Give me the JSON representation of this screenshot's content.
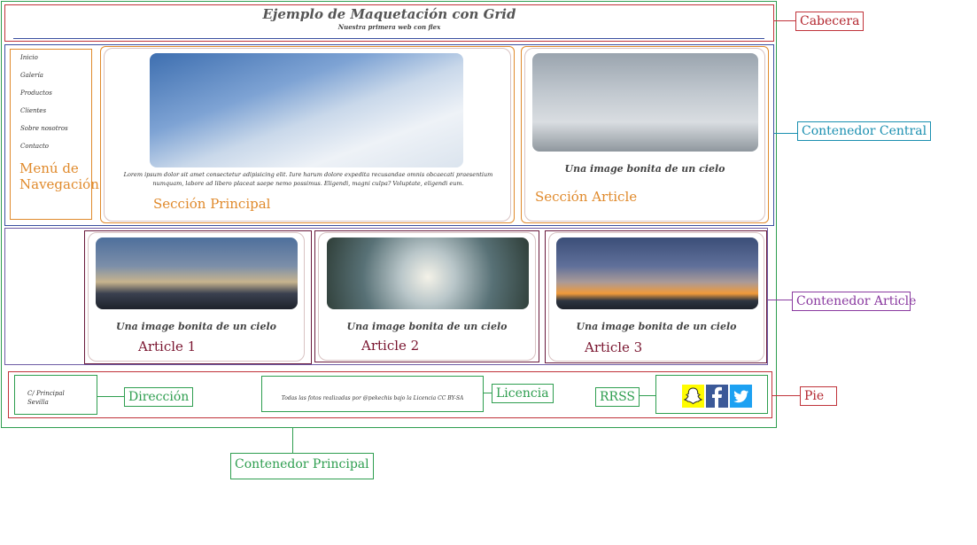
{
  "header": {
    "title": "Ejemplo de Maquetación con Grid",
    "subtitle": "Nuestra primera web con flex"
  },
  "nav": {
    "items": [
      "Inicio",
      "Galería",
      "Productos",
      "Clientes",
      "Sobre nosotros",
      "Contacto"
    ],
    "label": "Menú de Navegación"
  },
  "main_section": {
    "text": "Lorem ipsum dolor sit amet consectetur adipisicing elit. Iure harum dolore expedita recusandae omnis obcaecati praesentium numquam, labore ad libero placeat saepe nemo possimus. Eligendi, magni culpa? Voluptate, eligendi eum.",
    "label": "Sección Principal"
  },
  "article_section": {
    "caption": "Una image bonita de un cielo",
    "label": "Sección Article"
  },
  "articles": [
    {
      "caption": "Una image bonita de un cielo",
      "label": "Article 1"
    },
    {
      "caption": "Una image bonita de un cielo",
      "label": "Article 2"
    },
    {
      "caption": "Una image bonita de un cielo",
      "label": "Article 3"
    }
  ],
  "footer": {
    "address_line1": "C/ Principal",
    "address_line2": "Sevilla",
    "license_text": "Todas las fotos realizadas por @pekechis bajo la Licencia CC BY-SA",
    "address_label": "Dirección",
    "license_label": "Licencia",
    "rrss_label": "RRSS"
  },
  "annotations": {
    "cabecera": "Cabecera",
    "contenedor_central": "Contenedor Central",
    "contenedor_article": "Contenedor Article",
    "pie": "Pie",
    "contenedor_principal": "Contenedor Principal"
  },
  "icons": [
    "snapchat-icon",
    "facebook-icon",
    "twitter-icon"
  ],
  "colors": {
    "cabecera": "#c0333a",
    "central": "#1a8fb0",
    "article": "#8a3aa0",
    "principal": "#2e9e4f",
    "nav": "#e08a2c"
  }
}
